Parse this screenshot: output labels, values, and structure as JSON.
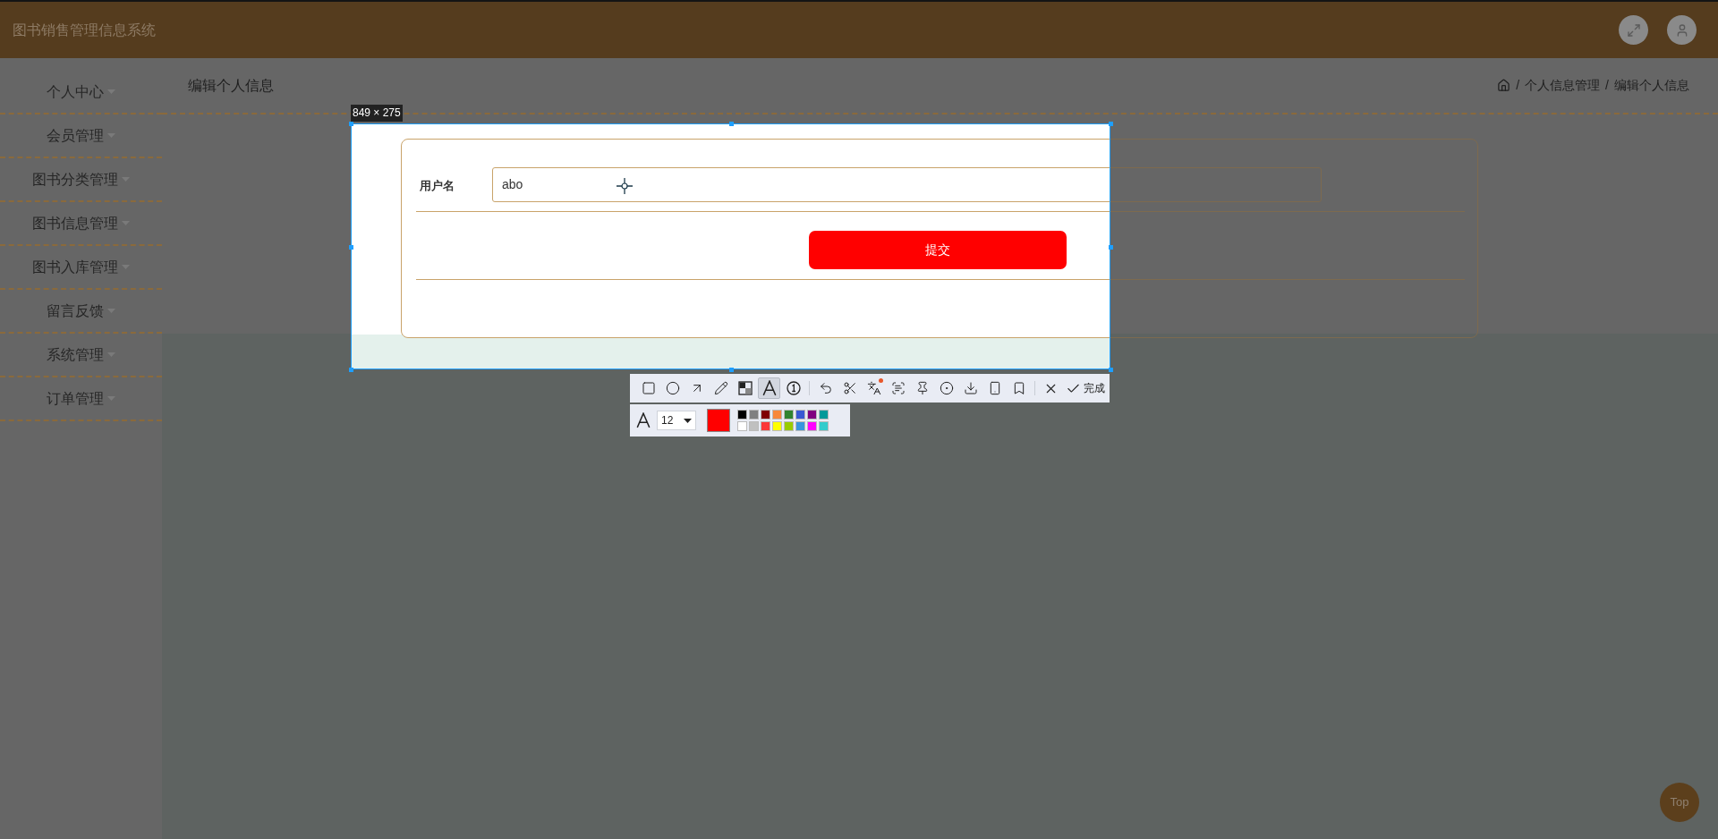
{
  "header": {
    "title": "图书销售管理信息系统"
  },
  "sidebar": {
    "items": [
      {
        "label": "个人中心"
      },
      {
        "label": "会员管理"
      },
      {
        "label": "图书分类管理"
      },
      {
        "label": "图书信息管理"
      },
      {
        "label": "图书入库管理"
      },
      {
        "label": "留言反馈"
      },
      {
        "label": "系统管理"
      },
      {
        "label": "订单管理"
      }
    ]
  },
  "page": {
    "title": "编辑个人信息",
    "breadcrumb_separator": "/",
    "breadcrumb": [
      "个人信息管理",
      "编辑个人信息"
    ]
  },
  "form": {
    "field_label": "用户名",
    "field_value": "abo",
    "submit": "提交"
  },
  "capture": {
    "size_label": "849 × 275",
    "tools": [
      {
        "kind": "rectangle",
        "selected": false
      },
      {
        "kind": "ellipse",
        "selected": false
      },
      {
        "kind": "arrow",
        "selected": false
      },
      {
        "kind": "pencil",
        "selected": false
      },
      {
        "kind": "mosaic",
        "selected": false
      },
      {
        "kind": "text",
        "selected": true
      },
      {
        "kind": "number",
        "selected": false
      },
      {
        "kind": "undo",
        "selected": false
      },
      {
        "kind": "cut",
        "selected": false
      },
      {
        "kind": "translate",
        "selected": false
      },
      {
        "kind": "ocr",
        "selected": false
      },
      {
        "kind": "pin",
        "selected": false
      },
      {
        "kind": "record",
        "selected": false
      },
      {
        "kind": "save",
        "selected": false
      },
      {
        "kind": "phone",
        "selected": false
      },
      {
        "kind": "bookmark",
        "selected": false
      }
    ],
    "done": "完成",
    "font_size": "12",
    "color_swatch": {
      "color": "#ff0000"
    },
    "palette": [
      {
        "color": "#000000"
      },
      {
        "color": "#808080"
      },
      {
        "color": "#800000"
      },
      {
        "color": "#f7883a"
      },
      {
        "color": "#308430"
      },
      {
        "color": "#385ad3"
      },
      {
        "color": "#800080"
      },
      {
        "color": "#009999"
      },
      {
        "color": "#ffffff"
      },
      {
        "color": "#c0c0c0"
      },
      {
        "color": "#fb3838"
      },
      {
        "color": "#ffff00"
      },
      {
        "color": "#99cc00"
      },
      {
        "color": "#3895de"
      },
      {
        "color": "#ff00ff"
      },
      {
        "color": "#33cccc"
      }
    ]
  },
  "top_button": "Top"
}
